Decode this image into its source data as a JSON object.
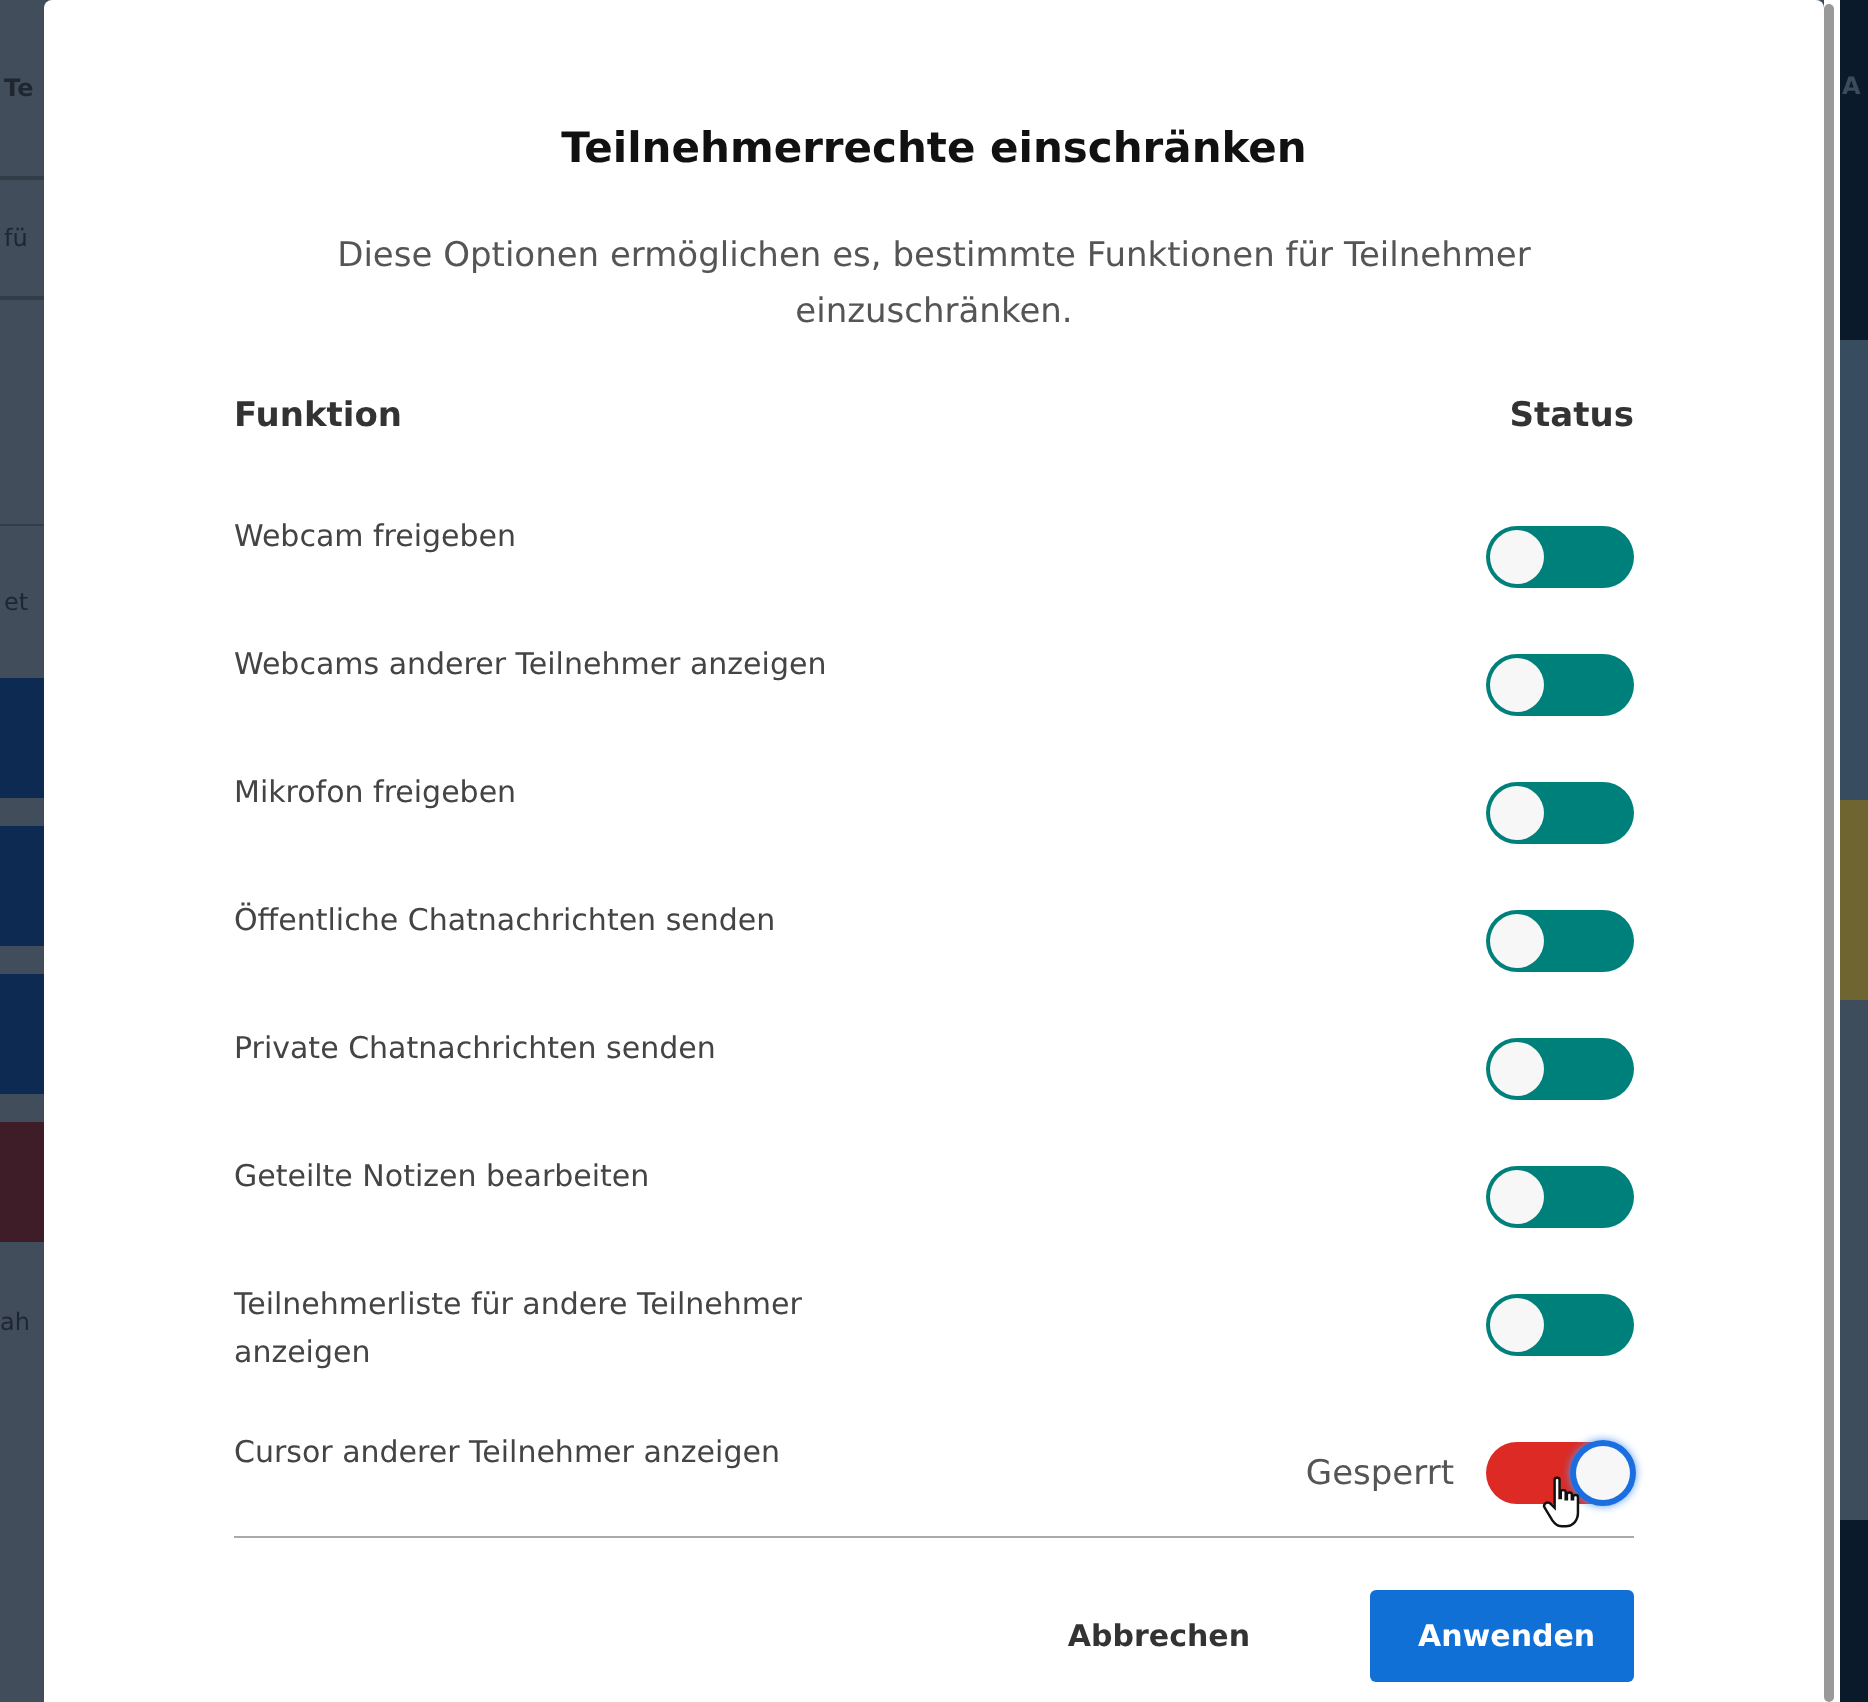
{
  "background": {
    "left_texts": [
      "Te",
      "fü",
      "et",
      "ah"
    ],
    "right_texts": [
      "A"
    ]
  },
  "dialog": {
    "title": "Teilnehmerrechte einschränken",
    "description": "Diese Optionen ermöglichen es, bestimmte Funktionen für Teilnehmer einzuschränken.",
    "columns": [
      "Funktion",
      "Status"
    ],
    "rows": [
      {
        "label": "Webcam freigeben",
        "locked": false
      },
      {
        "label": "Webcams anderer Teilnehmer anzeigen",
        "locked": false
      },
      {
        "label": "Mikrofon freigeben",
        "locked": false
      },
      {
        "label": "Öffentliche Chatnachrichten senden",
        "locked": false
      },
      {
        "label": "Private Chatnachrichten senden",
        "locked": false
      },
      {
        "label": "Geteilte Notizen bearbeiten",
        "locked": false
      },
      {
        "label": "Teilnehmerliste für andere Teilnehmer anzeigen",
        "locked": false
      },
      {
        "label": "Cursor anderer Teilnehmer anzeigen",
        "locked": true,
        "status_text": "Gesperrt"
      }
    ],
    "buttons": [
      {
        "label": "Abbrechen",
        "kind": "secondary"
      },
      {
        "label": "Anwenden",
        "kind": "primary"
      }
    ]
  }
}
